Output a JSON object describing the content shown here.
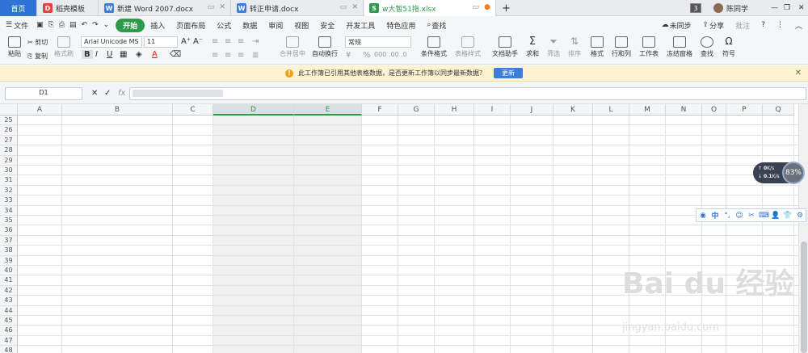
{
  "tabs": [
    {
      "label": "首页",
      "icon": ""
    },
    {
      "label": "稻壳模板",
      "icon": "D"
    },
    {
      "label": "新建 Word 2007.docx",
      "icon": "W"
    },
    {
      "label": "转正申请.docx",
      "icon": "W"
    },
    {
      "label": "w大暂51拖.xlsx",
      "icon": "S"
    }
  ],
  "window": {
    "count": "3",
    "user": "陈同学",
    "add_tab": "+"
  },
  "menu": {
    "file": "文件",
    "items": [
      "开始",
      "插入",
      "页面布局",
      "公式",
      "数据",
      "审阅",
      "视图",
      "安全",
      "开发工具",
      "特色应用"
    ],
    "search": "查找",
    "sync": "未同步",
    "share": "分享",
    "comment": "批注"
  },
  "toolbar": {
    "paste": "粘贴",
    "cut": "剪切",
    "copy": "复制",
    "format_painter": "格式刷",
    "font": "Arial Unicode MS",
    "size": "11",
    "bold": "B",
    "italic": "I",
    "underline": "U",
    "font_color": "A",
    "merge": "合并居中",
    "wrap": "自动换行",
    "number_format": "常规",
    "conditional": "条件格式",
    "table_style": "表格样式",
    "doc_helper": "文档助手",
    "sum": "求和",
    "filter": "筛选",
    "sort": "排序",
    "format": "格式",
    "rowcol": "行和列",
    "worksheet": "工作表",
    "freeze": "冻结窗格",
    "find": "查找",
    "symbol": "符号"
  },
  "notify": {
    "text": "此工作簿已引用其他表格数据，是否更新工作簿以同步最新数据？",
    "button": "更新"
  },
  "formula": {
    "cell": "D1",
    "fx": "fx"
  },
  "grid": {
    "columns": [
      "A",
      "B",
      "C",
      "D",
      "E",
      "F",
      "G",
      "H",
      "I",
      "J",
      "K",
      "L",
      "M",
      "N",
      "O",
      "P",
      "Q"
    ],
    "selected_cols": [
      "D",
      "E"
    ],
    "rows": [
      "25",
      "26",
      "27",
      "28",
      "29",
      "30",
      "31",
      "32",
      "33",
      "34",
      "35",
      "36",
      "37",
      "38",
      "39",
      "40",
      "41",
      "42",
      "43",
      "44",
      "45",
      "46",
      "47",
      "48"
    ]
  },
  "overlay": {
    "speed_up": "0",
    "speed_up_unit": "K/s",
    "speed_down": "0.1",
    "speed_down_unit": "K/s",
    "percent": "83%",
    "ime_mode": "中"
  },
  "watermark": {
    "brand": "Bai du 经验",
    "url": "jingyan.baidu.com"
  },
  "colors": {
    "accent": "#2e9a4b",
    "notify_bg": "#fef3d0",
    "update_btn": "#3c7ed6"
  }
}
